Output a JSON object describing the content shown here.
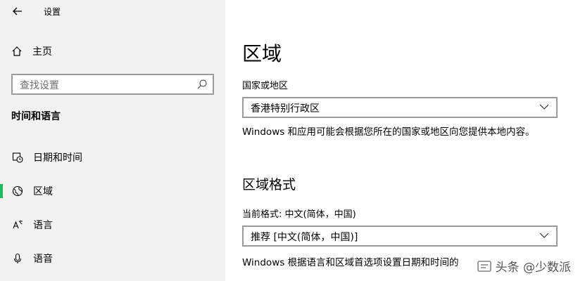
{
  "window": {
    "title": "设置"
  },
  "sidebar": {
    "home_label": "主页",
    "search_placeholder": "查找设置",
    "section_title": "时间和语言",
    "items": [
      {
        "label": "日期和时间",
        "icon": "calendar-clock-icon",
        "selected": false
      },
      {
        "label": "区域",
        "icon": "globe-icon",
        "selected": true
      },
      {
        "label": "语言",
        "icon": "language-icon",
        "selected": false
      },
      {
        "label": "语音",
        "icon": "microphone-icon",
        "selected": false
      }
    ]
  },
  "main": {
    "title": "区域",
    "country_label": "国家或地区",
    "country_value": "香港特别行政区",
    "country_desc": "Windows 和应用可能会根据您所在的国家或地区向您提供本地内容。",
    "format_title": "区域格式",
    "format_label": "当前格式: 中文(简体，中国)",
    "format_value": "推荐 [中文(简体，中国)]",
    "format_desc": "Windows 根据语言和区域首选项设置日期和时间的"
  },
  "watermark": {
    "text": "头条 @少数派"
  },
  "colors": {
    "accent": "#1fb861",
    "sidebar_bg": "#f2f2f2",
    "border": "#9a9a9a"
  }
}
